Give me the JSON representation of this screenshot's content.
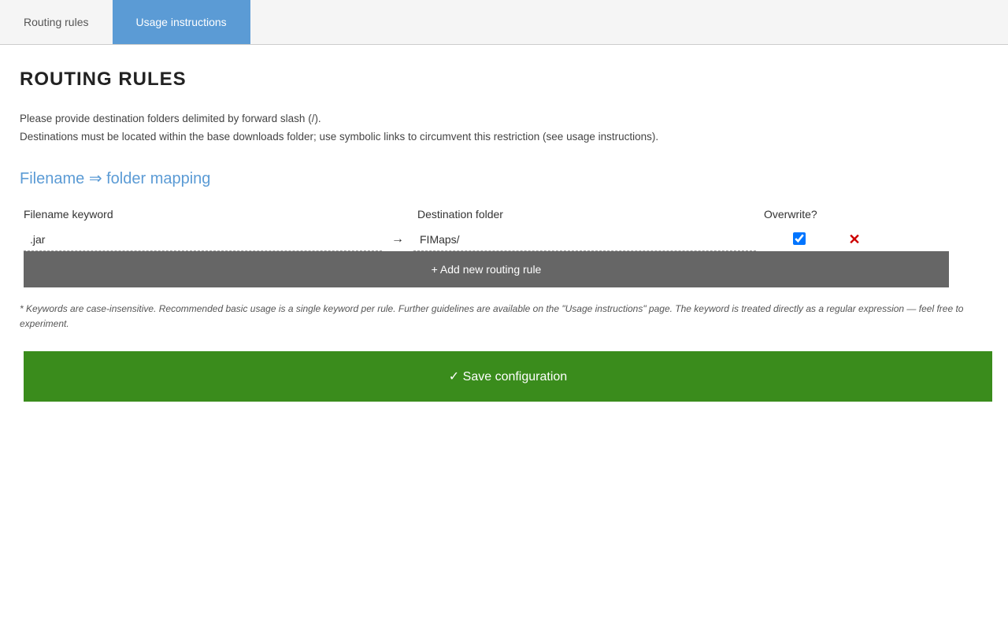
{
  "tabs": [
    {
      "id": "routing-rules",
      "label": "Routing rules",
      "active": false
    },
    {
      "id": "usage-instructions",
      "label": "Usage instructions",
      "active": true
    }
  ],
  "page": {
    "title": "ROUTING RULES",
    "description_line1": "Please provide destination folders delimited by forward slash (/).",
    "description_line2": "Destinations must be located within the base downloads folder; use symbolic links to circumvent this restriction (see usage instructions).",
    "section_heading": "Filename ⇒ folder mapping",
    "columns": {
      "keyword": "Filename keyword",
      "destination": "Destination folder",
      "overwrite": "Overwrite?"
    },
    "rules": [
      {
        "keyword": ".jar",
        "destination": "FIMaps/",
        "overwrite": true
      }
    ],
    "add_rule_label": "+ Add new routing rule",
    "footer_note": "* Keywords are case-insensitive. Recommended basic usage is a single keyword per rule. Further guidelines are available on the \"Usage instructions\" page. The keyword is treated directly as a regular expression — feel free to experiment.",
    "save_label": "✓ Save configuration"
  }
}
